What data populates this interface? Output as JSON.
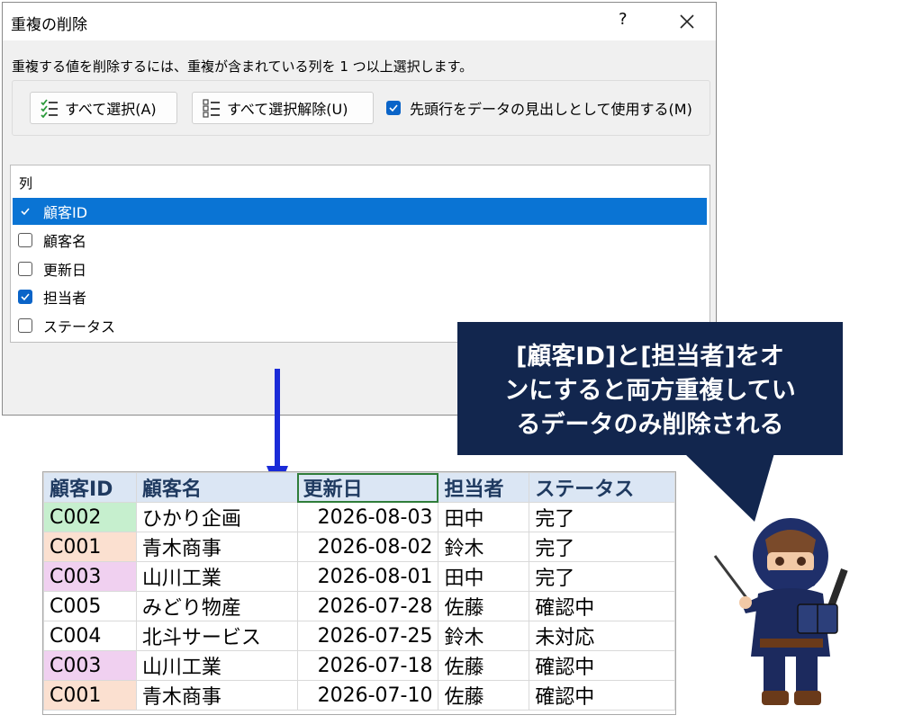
{
  "dialog": {
    "title": "重複の削除",
    "help": "?",
    "instruction": "重複する値を削除するには、重複が含まれている列を 1 つ以上選択します。",
    "select_all": "すべて選択(A)",
    "deselect_all": "すべて選択解除(U)",
    "header_checkbox_label": "先頭行をデータの見出しとして使用する(M)",
    "columns_header": "列",
    "columns": [
      {
        "label": "顧客ID",
        "checked": true
      },
      {
        "label": "顧客名",
        "checked": false
      },
      {
        "label": "更新日",
        "checked": false
      },
      {
        "label": "担当者",
        "checked": true
      },
      {
        "label": "ステータス",
        "checked": false
      }
    ]
  },
  "callout": {
    "lines": [
      "[顧客ID]と[担当者]をオ",
      "ンにすると両方重複してい",
      "るデータのみ削除される"
    ]
  },
  "sheet": {
    "headers": [
      "顧客ID",
      "顧客名",
      "更新日",
      "担当者",
      "ステータス"
    ],
    "rows": [
      [
        "C002",
        "ひかり企画",
        "2026-08-03",
        "田中",
        "完了"
      ],
      [
        "C001",
        "青木商事",
        "2026-08-02",
        "鈴木",
        "完了"
      ],
      [
        "C003",
        "山川工業",
        "2026-08-01",
        "田中",
        "完了"
      ],
      [
        "C005",
        "みどり物産",
        "2026-07-28",
        "佐藤",
        "確認中"
      ],
      [
        "C004",
        "北斗サービス",
        "2026-07-25",
        "鈴木",
        "未対応"
      ],
      [
        "C003",
        "山川工業",
        "2026-07-18",
        "佐藤",
        "確認中"
      ],
      [
        "C001",
        "青木商事",
        "2026-07-10",
        "佐藤",
        "確認中"
      ]
    ],
    "row_highlight_colors": [
      "#c6efce",
      "#fbe0d0",
      "#f0d0f0",
      "",
      "",
      "#f0d0f0",
      "#fbe0d0"
    ],
    "header_color": "#dbe6f4"
  },
  "colors": {
    "accent": "#0a74d4",
    "bubble": "#12264e",
    "arrow": "#1a2bd8"
  }
}
